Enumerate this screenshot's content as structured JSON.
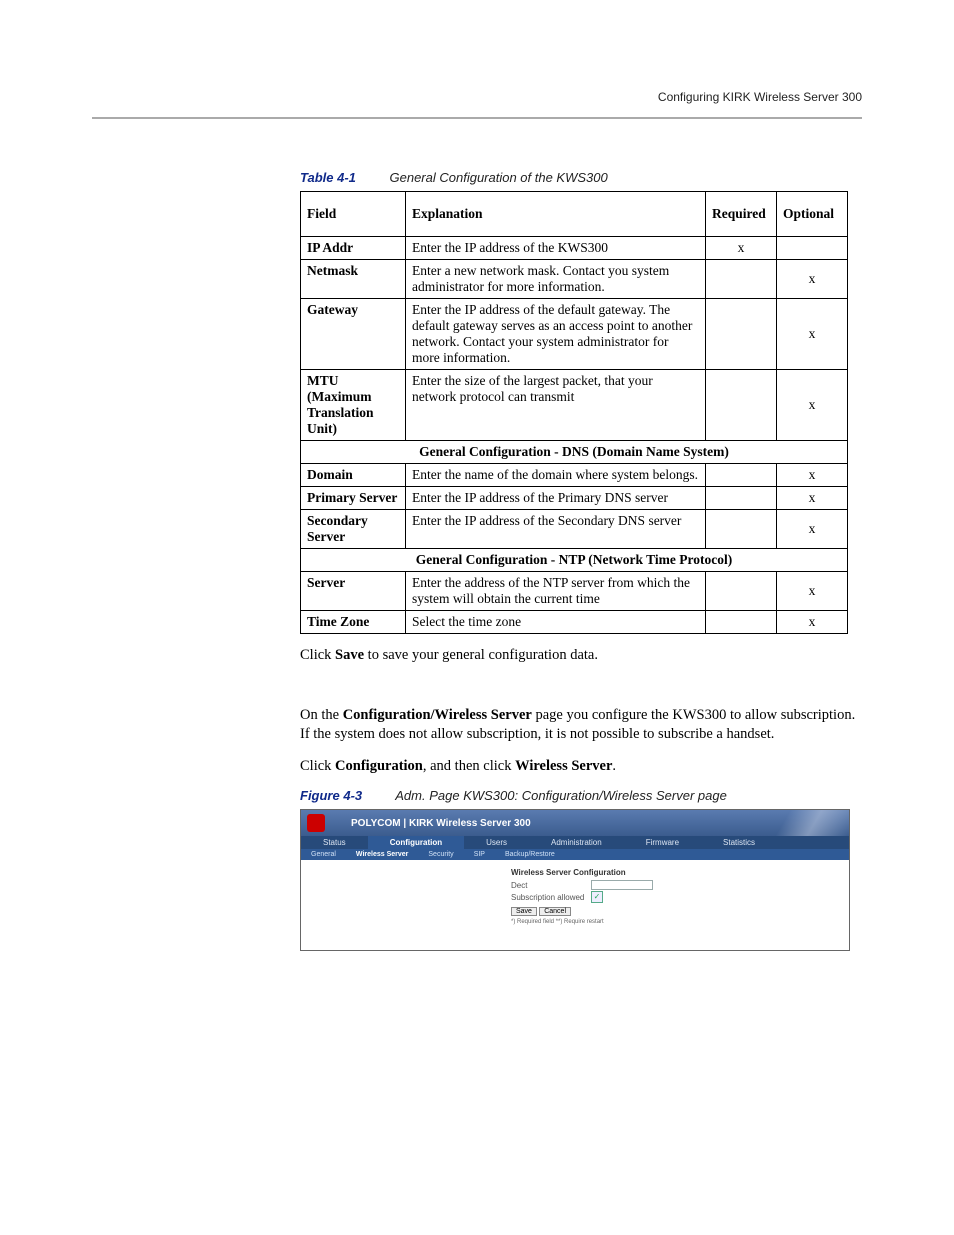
{
  "header": {
    "running_title": "Configuring KIRK Wireless Server 300"
  },
  "table_caption": {
    "label": "Table 4-1",
    "text": "General Configuration of the KWS300"
  },
  "table": {
    "headers": {
      "field": "Field",
      "explanation": "Explanation",
      "required": "Required",
      "optional": "Optional"
    },
    "rows": [
      {
        "field": "IP Addr",
        "explanation": "Enter the IP address of the KWS300",
        "required": "x",
        "optional": "",
        "tall": true
      },
      {
        "field": "Netmask",
        "explanation": "Enter a new network mask. Contact you system administrator for more information.",
        "required": "",
        "optional": "x"
      },
      {
        "field": "Gateway",
        "explanation": "Enter the IP address of the default gateway. The default gateway serves as an access point to another network. Contact your system administrator for more information.",
        "required": "",
        "optional": "x"
      },
      {
        "field": "MTU (Maximum Translation Unit)",
        "explanation": "Enter the size of the largest packet, that your network protocol can transmit",
        "required": "",
        "optional": "x"
      }
    ],
    "section1": "General Configuration - DNS (Domain Name System)",
    "rows2": [
      {
        "field": "Domain",
        "explanation": "Enter the name of the domain where system belongs.",
        "required": "",
        "optional": "x"
      },
      {
        "field": "Primary Server",
        "explanation": "Enter the IP address of the Primary DNS server",
        "required": "",
        "optional": "x"
      },
      {
        "field": "Secondary Server",
        "explanation": "Enter the IP address of the Secondary DNS server",
        "required": "",
        "optional": "x"
      }
    ],
    "section2": "General Configuration - NTP (Network Time Protocol)",
    "rows3": [
      {
        "field": "Server",
        "explanation": "Enter the address of the NTP server from which the system will obtain the current time",
        "required": "",
        "optional": "x"
      },
      {
        "field": "Time Zone",
        "explanation": "Select the time zone",
        "required": "",
        "optional": "x",
        "tall": true
      }
    ]
  },
  "paragraphs": {
    "p1_a": "Click ",
    "p1_b": "Save",
    "p1_c": " to save your general configuration data.",
    "p2_a": "On the ",
    "p2_b": "Configuration/Wireless Server",
    "p2_c": " page you configure the KWS300 to allow subscription. If the system does not allow subscription, it is not possible to subscribe a handset.",
    "p3_a": "Click ",
    "p3_b": "Configuration",
    "p3_c": ", and then click ",
    "p3_d": "Wireless Server",
    "p3_e": "."
  },
  "figure_caption": {
    "label": "Figure 4-3",
    "text": "Adm. Page KWS300: Configuration/Wireless Server page"
  },
  "figure": {
    "brand": "POLYCOM  |  KIRK Wireless Server 300",
    "tabs1": [
      "Status",
      "Configuration",
      "Users",
      "Administration",
      "Firmware",
      "Statistics"
    ],
    "tabs1_active_index": 1,
    "tabs2": [
      "General",
      "Wireless Server",
      "Security",
      "SIP",
      "Backup/Restore"
    ],
    "tabs2_active_index": 1,
    "panel_title": "Wireless Server Configuration",
    "row_dect": "Dect",
    "row_sub": "Subscription allowed",
    "btn_save": "Save",
    "btn_cancel": "Cancel",
    "footnote": "*) Required field  **) Require restart"
  }
}
